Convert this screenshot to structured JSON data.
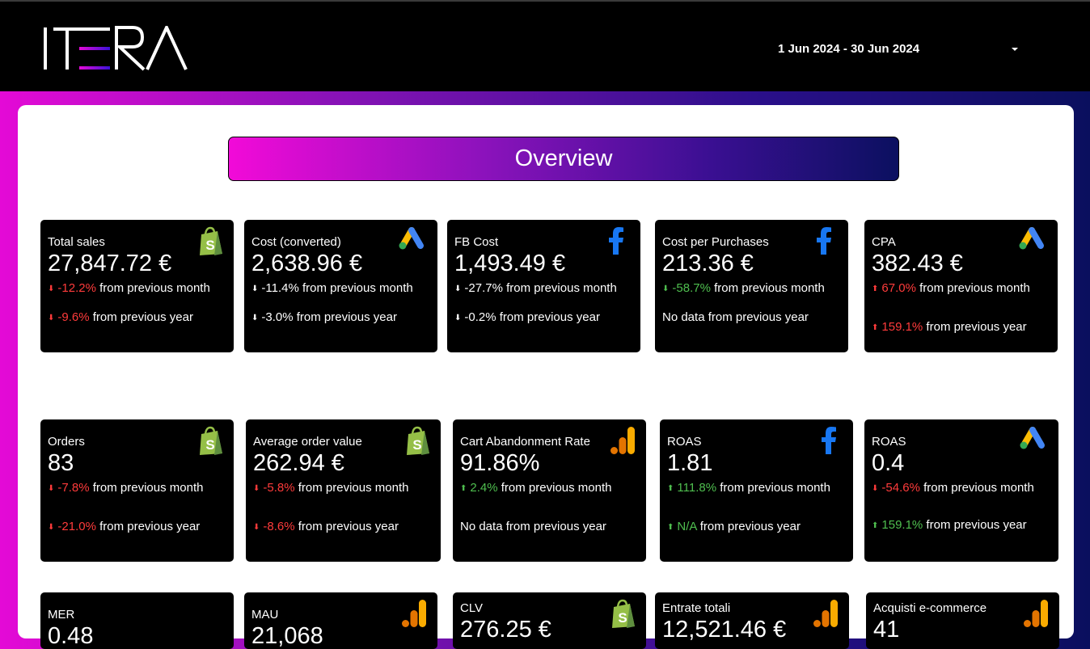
{
  "header": {
    "logo_text": "ITERA",
    "date_range": "1 Jun 2024 - 30 Jun 2024"
  },
  "overview_title": "Overview",
  "comparison_labels": {
    "month": "from previous month",
    "year": "from previous year",
    "no_data_year": "No data from previous year"
  },
  "cards": [
    {
      "title": "Total sales",
      "value": "27,847.72 €",
      "icon": "shopify-icon",
      "month": "-12.2%",
      "month_dir": "down",
      "month_color": "#ff3b3b",
      "year": "-9.6%",
      "year_dir": "down",
      "year_color": "#ff3b3b"
    },
    {
      "title": "Cost (converted)",
      "value": "2,638.96 €",
      "icon": "google-ads-icon",
      "month": "-11.4%",
      "month_dir": "down",
      "month_color": "#ffffff",
      "year": "-3.0%",
      "year_dir": "down",
      "year_color": "#ffffff"
    },
    {
      "title": "FB Cost",
      "value": "1,493.49 €",
      "icon": "facebook-icon",
      "month": "-27.7%",
      "month_dir": "down",
      "month_color": "#ffffff",
      "year": "-0.2%",
      "year_dir": "down",
      "year_color": "#ffffff"
    },
    {
      "title": "Cost per Purchases",
      "value": "213.36 €",
      "icon": "facebook-icon",
      "month": "-58.7%",
      "month_dir": "down",
      "month_color": "#4fbf4f",
      "year": "",
      "year_dir": "none",
      "year_color": "#ffffff"
    },
    {
      "title": "CPA",
      "value": "382.43 €",
      "icon": "google-ads-icon",
      "month": "67.0%",
      "month_dir": "up",
      "month_color": "#ff3b3b",
      "year": "159.1%",
      "year_dir": "up",
      "year_color": "#ff3b3b"
    },
    {
      "title": "Orders",
      "value": "83",
      "icon": "shopify-icon",
      "month": "-7.8%",
      "month_dir": "down",
      "month_color": "#ff3b3b",
      "year": "-21.0%",
      "year_dir": "down",
      "year_color": "#ff3b3b"
    },
    {
      "title": "Average order value",
      "value": "262.94 €",
      "icon": "shopify-icon",
      "month": "-5.8%",
      "month_dir": "down",
      "month_color": "#ff3b3b",
      "year": "-8.6%",
      "year_dir": "down",
      "year_color": "#ff3b3b"
    },
    {
      "title": "Cart Abandonment Rate",
      "value": "91.86%",
      "icon": "google-analytics-icon",
      "month": "2.4%",
      "month_dir": "up",
      "month_color": "#4fbf4f",
      "year": "",
      "year_dir": "none",
      "year_color": "#ffffff"
    },
    {
      "title": "ROAS",
      "value": "1.81",
      "icon": "facebook-icon",
      "month": "111.8%",
      "month_dir": "up",
      "month_color": "#4fbf4f",
      "year": "N/A",
      "year_dir": "up",
      "year_color": "#4fbf4f"
    },
    {
      "title": "ROAS",
      "value": "0.4",
      "icon": "google-ads-icon",
      "month": "-54.6%",
      "month_dir": "down",
      "month_color": "#ff3b3b",
      "year": "159.1%",
      "year_dir": "up",
      "year_color": "#4fbf4f"
    },
    {
      "title": "MER",
      "value": "0.48",
      "icon": "",
      "month": "",
      "month_dir": "none",
      "month_color": "#ffffff",
      "year": "",
      "year_dir": "none",
      "year_color": "#ffffff"
    },
    {
      "title": "MAU",
      "value": "21,068",
      "icon": "google-analytics-icon",
      "month": "",
      "month_dir": "none",
      "month_color": "#ffffff",
      "year": "",
      "year_dir": "none",
      "year_color": "#ffffff"
    },
    {
      "title": "CLV",
      "value": "276.25 €",
      "icon": "shopify-icon",
      "month": "",
      "month_dir": "none",
      "month_color": "#ffffff",
      "year": "",
      "year_dir": "none",
      "year_color": "#ffffff"
    },
    {
      "title": "Entrate totali",
      "value": "12,521.46 €",
      "icon": "google-analytics-icon",
      "month": "",
      "month_dir": "none",
      "month_color": "#ffffff",
      "year": "",
      "year_dir": "none",
      "year_color": "#ffffff"
    },
    {
      "title": "Acquisti e-commerce",
      "value": "41",
      "icon": "google-analytics-icon",
      "month": "",
      "month_dir": "none",
      "month_color": "#ffffff",
      "year": "",
      "year_dir": "none",
      "year_color": "#ffffff"
    }
  ]
}
